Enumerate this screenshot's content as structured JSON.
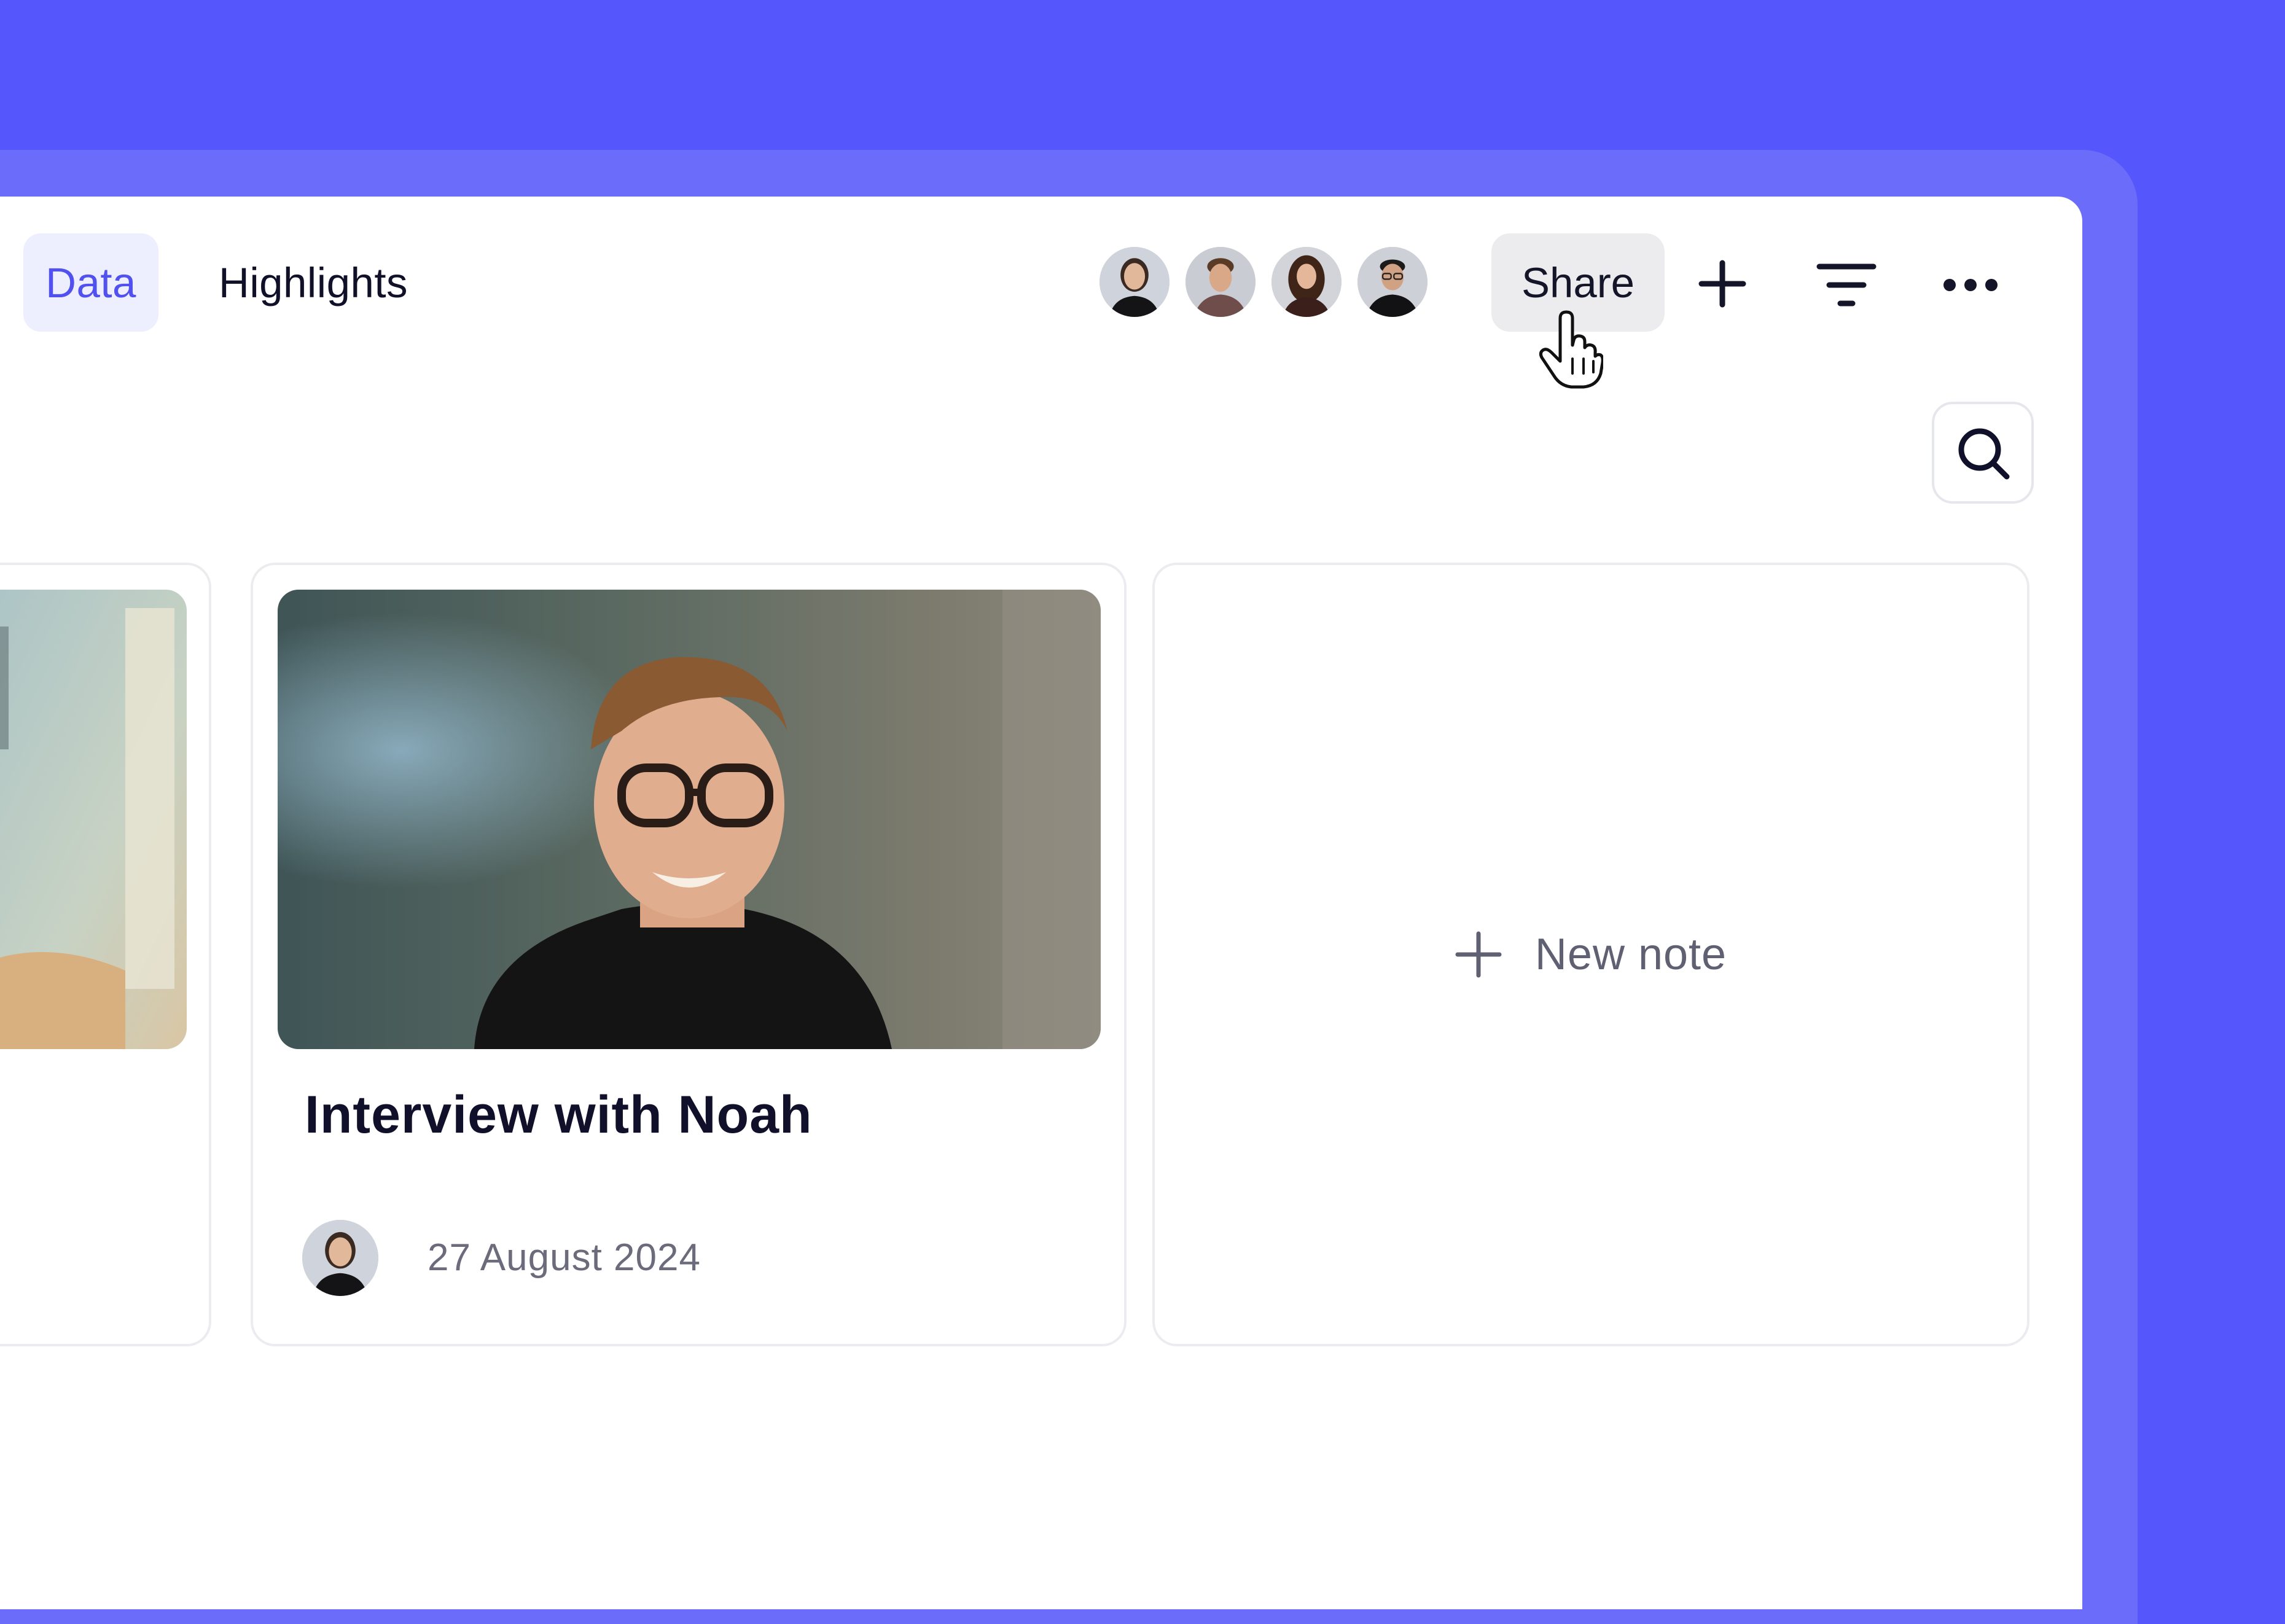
{
  "tabs": {
    "data_label": "Data",
    "highlights_label": "Highlights"
  },
  "toolbar": {
    "share_label": "Share",
    "icons": [
      "plus-icon",
      "filter-icon",
      "more-icon",
      "search-icon"
    ]
  },
  "collaborators": [
    "avatar-1",
    "avatar-2",
    "avatar-3",
    "avatar-4"
  ],
  "cards": {
    "interview": {
      "title": "Interview with Noah",
      "date": "27 August 2024"
    },
    "new_note": {
      "label": "New note"
    }
  },
  "colors": {
    "background": "#5656fd",
    "accent": "#5151f0",
    "tab_active_bg": "#eeeffe"
  }
}
